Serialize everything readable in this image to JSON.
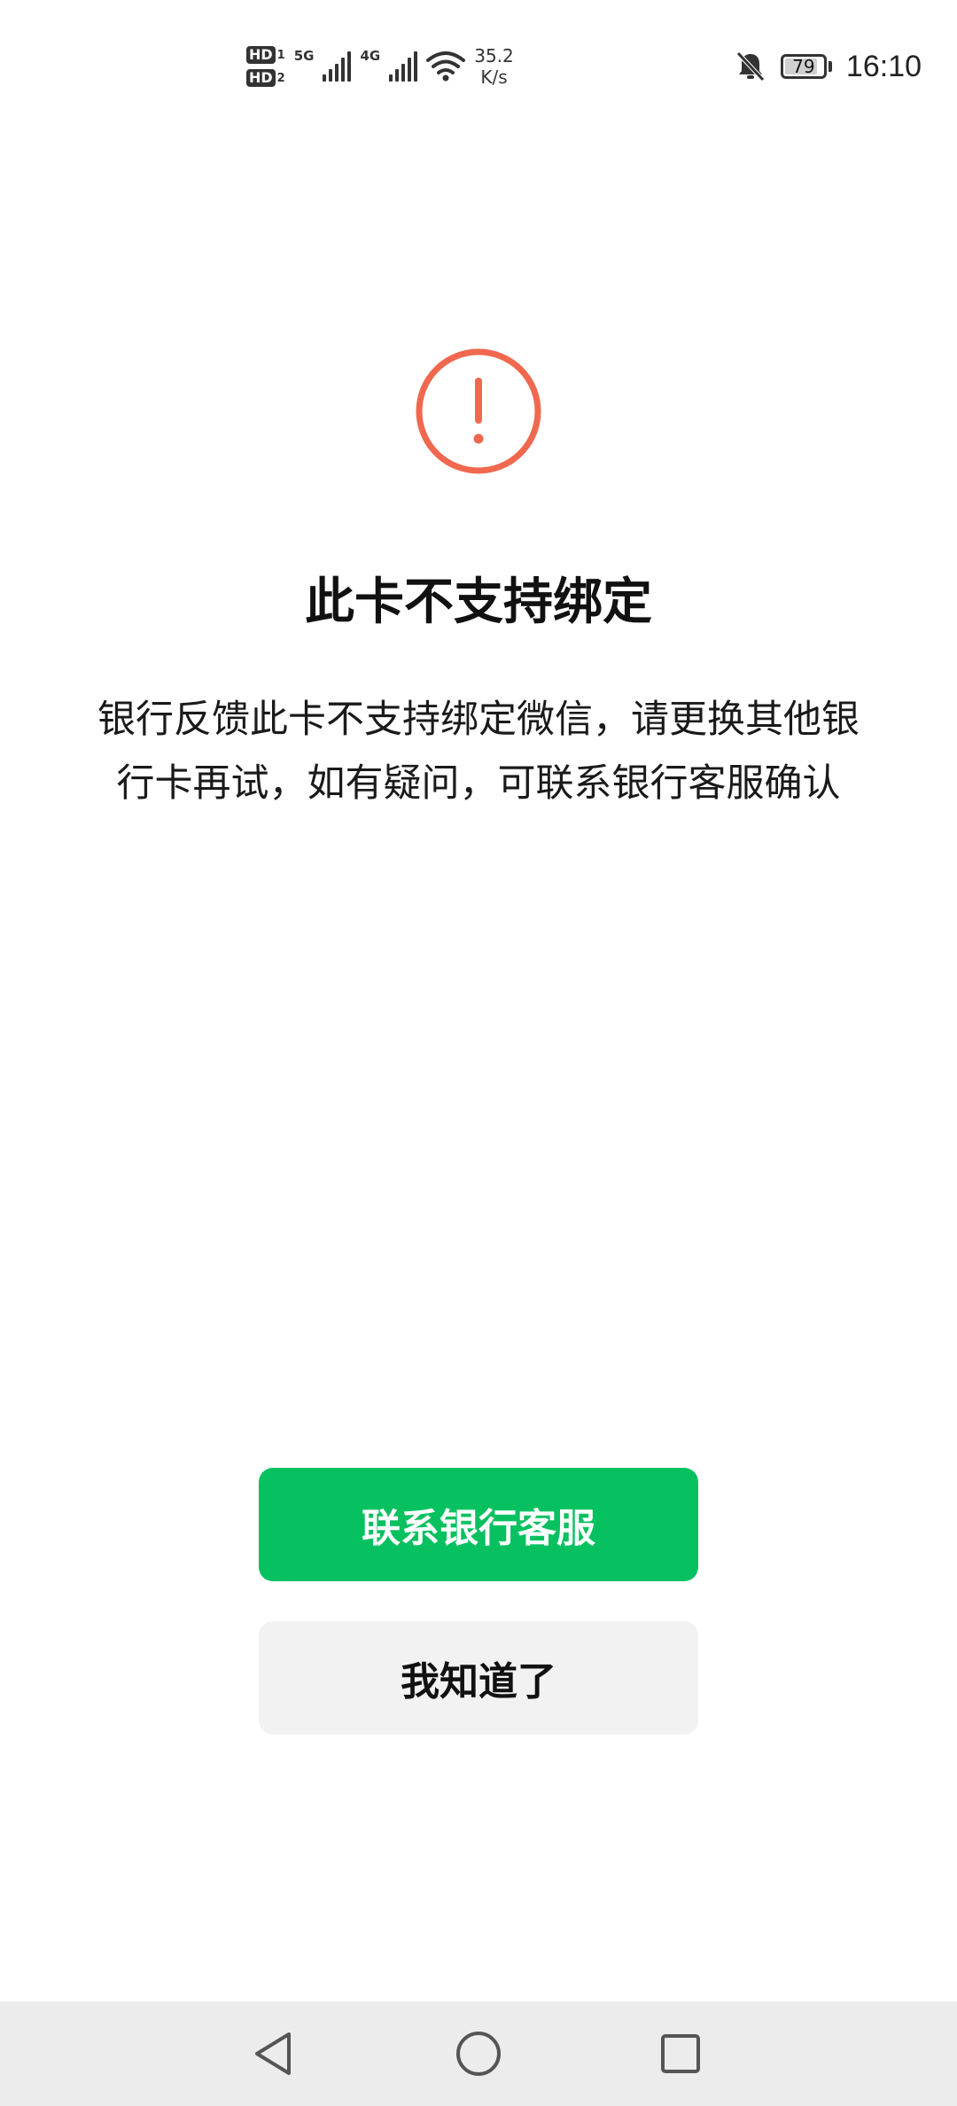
{
  "status_bar": {
    "sim1_label": "HD",
    "sim1_index": "1",
    "sim2_label": "HD",
    "sim2_index": "2",
    "net1_type": "5G",
    "net2_type": "4G",
    "net_speed_value": "35.2",
    "net_speed_unit": "K/s",
    "battery_level": "79",
    "time": "16:10"
  },
  "dialog": {
    "icon": "exclamation-circle-icon",
    "icon_color": "#f0684f",
    "title": "此卡不支持绑定",
    "message": "银行反馈此卡不支持绑定微信，请更换其他银行卡再试，如有疑问，可联系银行客服确认",
    "primary_button": "联系银行客服",
    "secondary_button": "我知道了"
  },
  "colors": {
    "primary": "#07c160",
    "secondary_bg": "#f2f2f2",
    "nav_bar_bg": "#ececec"
  },
  "nav_bar": {
    "back": "back-triangle-icon",
    "home": "home-circle-icon",
    "recent": "recent-apps-square-icon"
  }
}
